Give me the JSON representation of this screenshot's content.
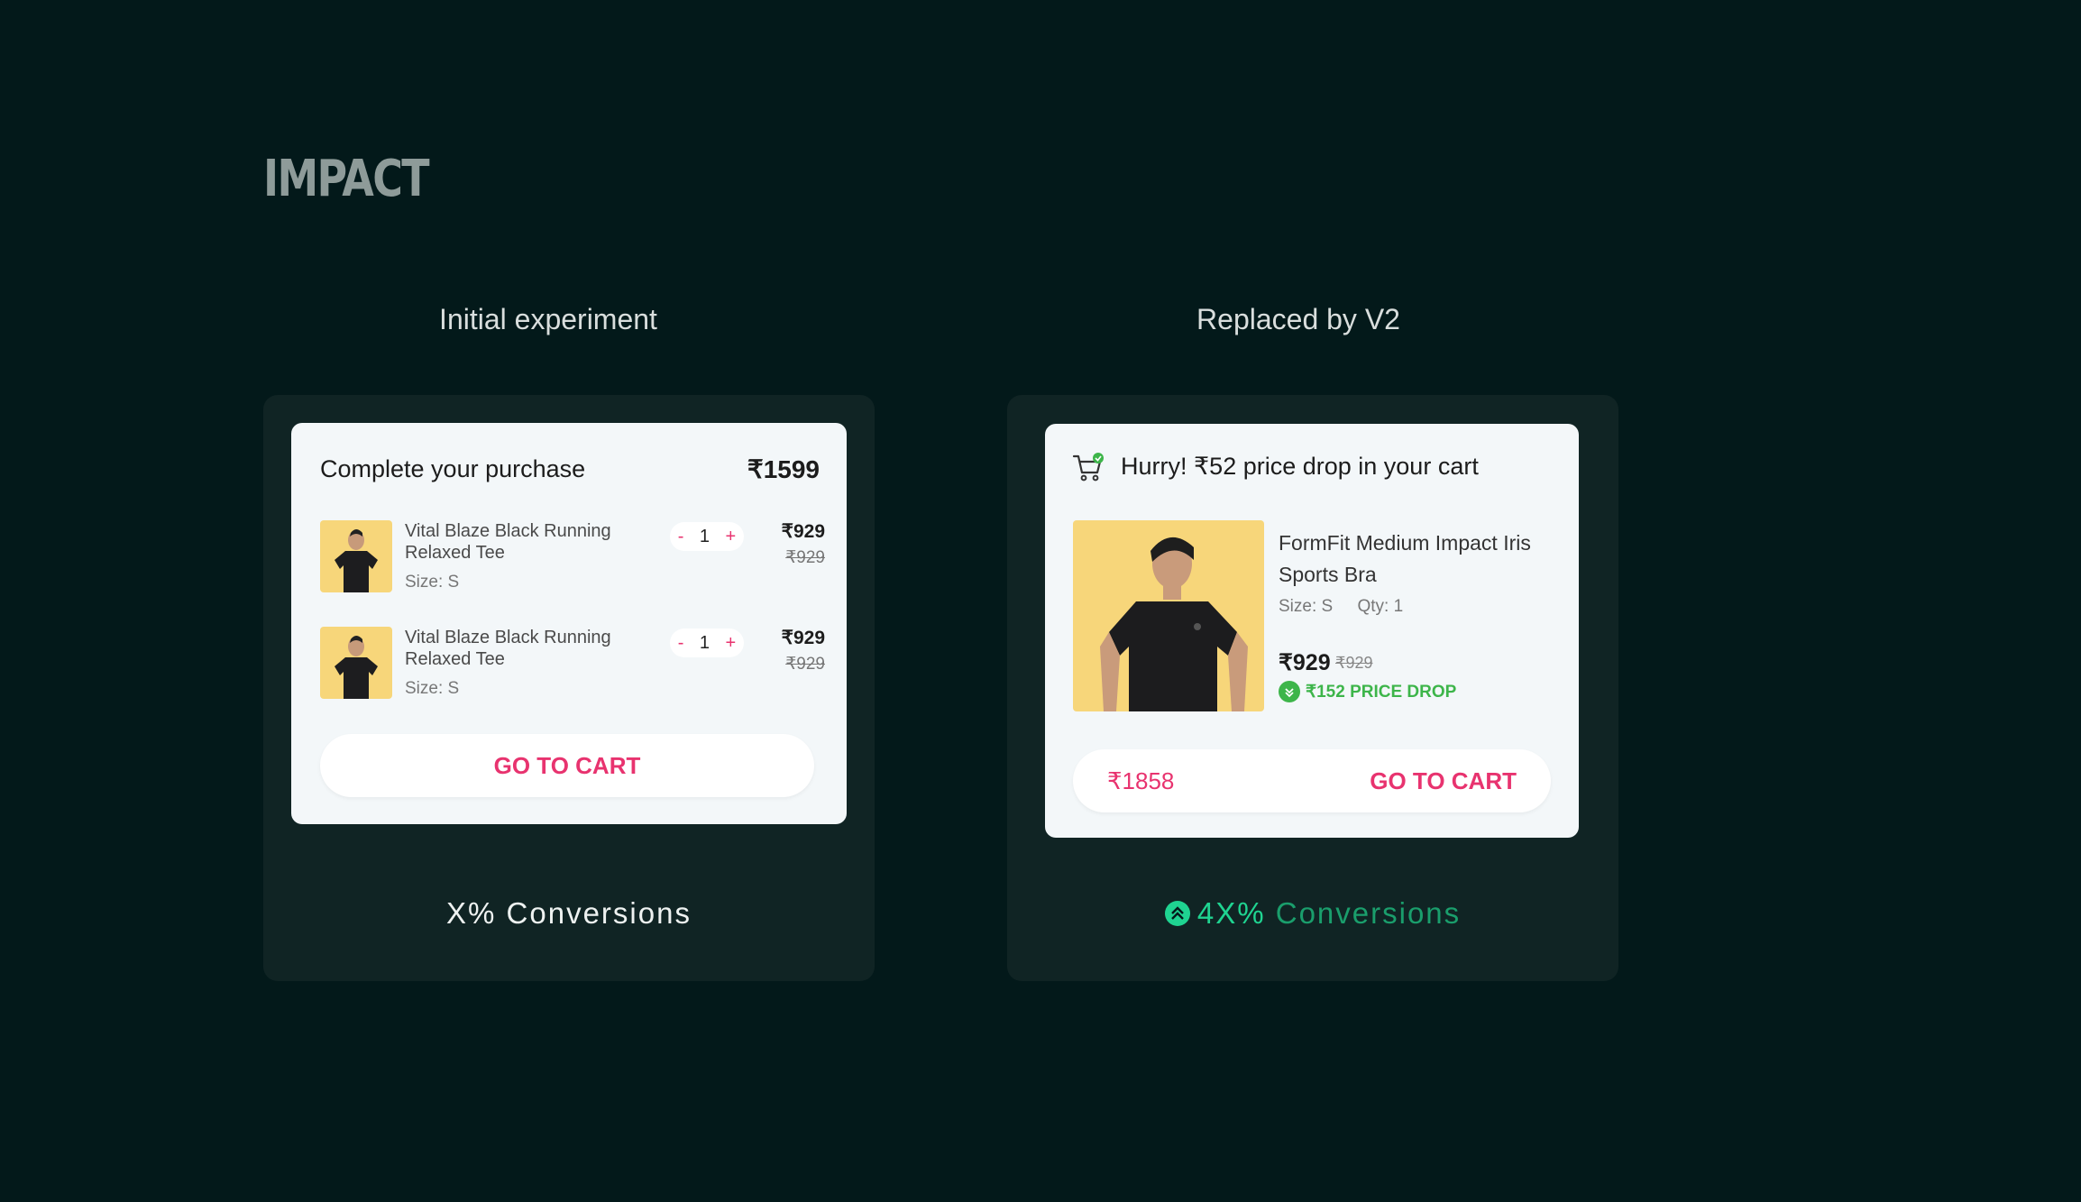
{
  "heading": "IMPACT",
  "left": {
    "title": "Initial experiment",
    "card": {
      "title": "Complete your purchase",
      "total": "₹1599",
      "items": [
        {
          "name": "Vital Blaze Black Running Relaxed Tee",
          "size": "Size: S",
          "qty": "1",
          "minus": "-",
          "plus": "+",
          "price": "₹929",
          "was": "₹929"
        },
        {
          "name": "Vital Blaze Black Running Relaxed Tee",
          "size": "Size: S",
          "qty": "1",
          "minus": "-",
          "plus": "+",
          "price": "₹929",
          "was": "₹929"
        }
      ],
      "cta": "GO TO CART"
    },
    "conversion": "X% Conversions"
  },
  "right": {
    "title": "Replaced by V2",
    "card": {
      "headline": "Hurry! ₹52 price drop in your cart",
      "product_name": "FormFit Medium Impact Iris Sports Bra",
      "size": "Size: S",
      "qty": "Qty: 1",
      "price": "₹929",
      "was": "₹929",
      "drop": "₹152 PRICE DROP",
      "cta_total": "₹1858",
      "cta": "GO TO CART"
    },
    "conversion_value": "4X%",
    "conversion_label": "Conversions"
  },
  "colors": {
    "background": "#03191a",
    "panel": "#102424",
    "accent_pink": "#e8336f",
    "success_green": "#3db54a",
    "conversion_green": "#1fd491"
  },
  "icons": [
    "cart-icon",
    "check-badge-icon",
    "chevron-down-badge-icon",
    "chevron-up-badge-icon"
  ]
}
